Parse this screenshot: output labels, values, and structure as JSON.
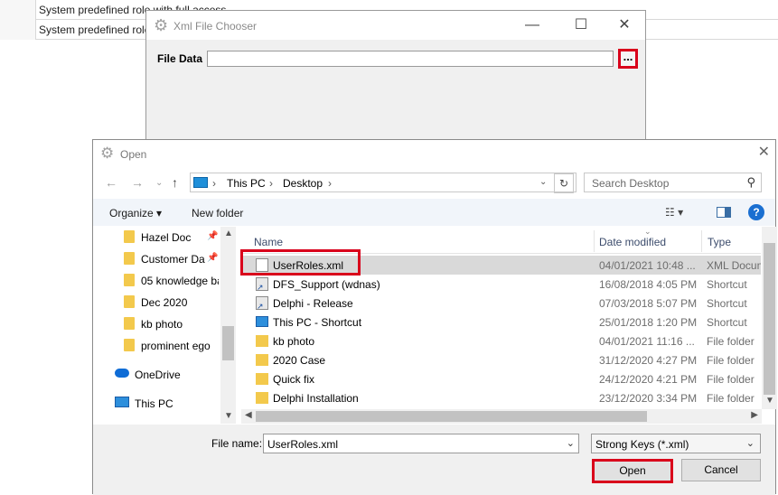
{
  "background": {
    "rows": [
      "System predefined role with full access",
      "System predefined role v"
    ]
  },
  "xml_chooser": {
    "title": "Xml File Chooser",
    "file_label": "File Data",
    "file_value": "",
    "browse_label": "..."
  },
  "open_dialog": {
    "title": "Open",
    "breadcrumb": [
      "This PC",
      "Desktop"
    ],
    "search_placeholder": "Search Desktop",
    "toolbar": {
      "organize": "Organize",
      "new_folder": "New folder"
    },
    "nav": [
      {
        "label": "Hazel Doc",
        "pinned": true
      },
      {
        "label": "Customer Da",
        "pinned": true
      },
      {
        "label": "05 knowledge ba",
        "pinned": false
      },
      {
        "label": "Dec 2020",
        "pinned": false
      },
      {
        "label": "kb photo",
        "pinned": false
      },
      {
        "label": "prominent ego",
        "pinned": false
      }
    ],
    "onedrive": "OneDrive",
    "thispc": "This PC",
    "columns": {
      "name": "Name",
      "date": "Date modified",
      "type": "Type"
    },
    "files": [
      {
        "name": "UserRoles.xml",
        "date": "04/01/2021 10:48 ...",
        "type": "XML Document",
        "icon": "document-icon"
      },
      {
        "name": "DFS_Support (wdnas)",
        "date": "16/08/2018 4:05 PM",
        "type": "Shortcut",
        "icon": "shortcut-icon"
      },
      {
        "name": "Delphi - Release",
        "date": "07/03/2018 5:07 PM",
        "type": "Shortcut",
        "icon": "shortcut-icon"
      },
      {
        "name": "This PC - Shortcut",
        "date": "25/01/2018 1:20 PM",
        "type": "Shortcut",
        "icon": "computer-icon"
      },
      {
        "name": "kb photo",
        "date": "04/01/2021 11:16 ...",
        "type": "File folder",
        "icon": "folder-icon"
      },
      {
        "name": "2020 Case",
        "date": "31/12/2020 4:27 PM",
        "type": "File folder",
        "icon": "folder-icon"
      },
      {
        "name": "Quick fix",
        "date": "24/12/2020 4:21 PM",
        "type": "File folder",
        "icon": "folder-icon"
      },
      {
        "name": "Delphi Installation",
        "date": "23/12/2020 3:34 PM",
        "type": "File folder",
        "icon": "folder-icon"
      }
    ],
    "filename_label": "File name:",
    "filename_value": "UserRoles.xml",
    "filter_value": "Strong Keys (*.xml)",
    "open_label": "Open",
    "cancel_label": "Cancel"
  },
  "colors": {
    "highlight": "#d9001b",
    "selection": "#d9d9d9",
    "accent": "#1a6fd1"
  }
}
